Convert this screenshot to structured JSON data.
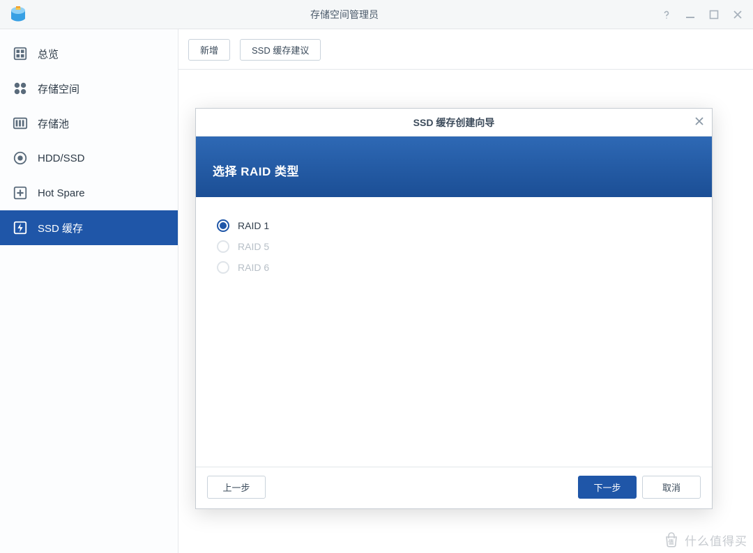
{
  "window": {
    "title": "存储空间管理员"
  },
  "sidebar": {
    "items": [
      {
        "label": "总览"
      },
      {
        "label": "存储空间"
      },
      {
        "label": "存储池"
      },
      {
        "label": "HDD/SSD"
      },
      {
        "label": "Hot Spare"
      },
      {
        "label": "SSD 缓存"
      }
    ]
  },
  "toolbar": {
    "new_label": "新增",
    "ssd_advice_label": "SSD 缓存建议"
  },
  "modal": {
    "title": "SSD 缓存创建向导",
    "heading": "选择 RAID 类型",
    "options": [
      {
        "label": "RAID 1",
        "selected": true,
        "disabled": false
      },
      {
        "label": "RAID 5",
        "selected": false,
        "disabled": true
      },
      {
        "label": "RAID 6",
        "selected": false,
        "disabled": true
      }
    ],
    "footer": {
      "back": "上一步",
      "next": "下一步",
      "cancel": "取消"
    }
  },
  "watermark": {
    "text": "什么值得买"
  }
}
